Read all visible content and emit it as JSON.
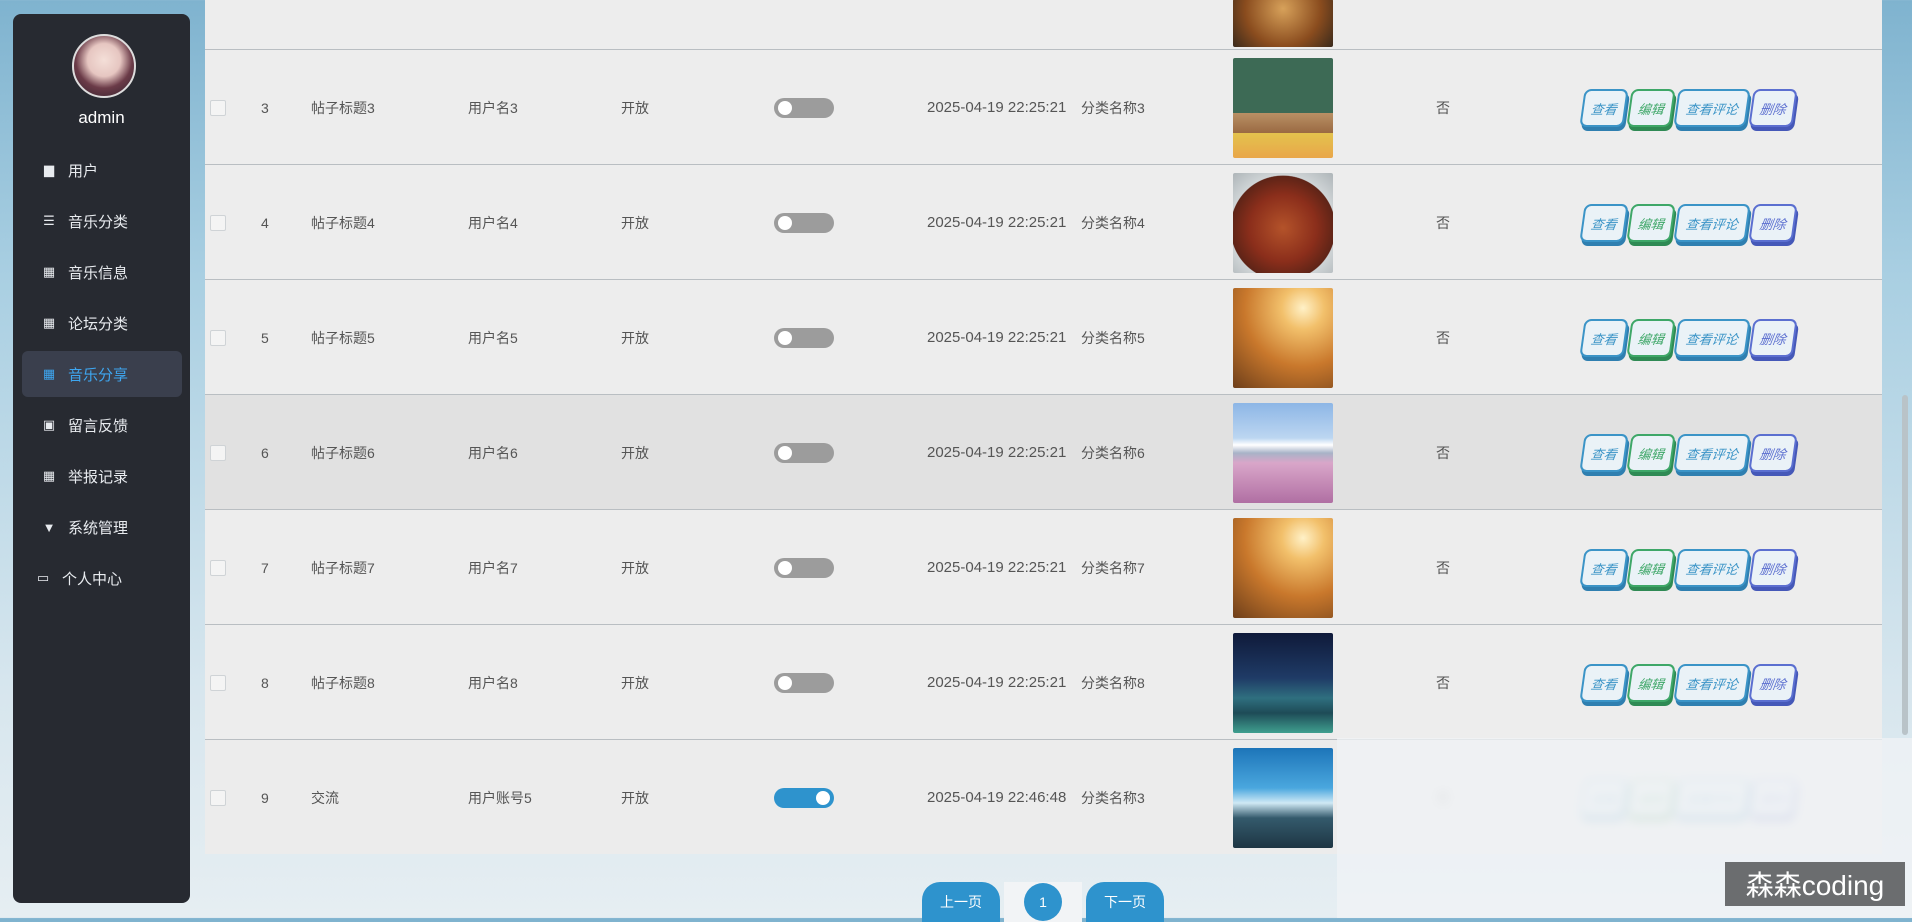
{
  "sidebar": {
    "username": "admin",
    "items": [
      {
        "label": "用户",
        "icon": "briefcase-icon"
      },
      {
        "label": "音乐分类",
        "icon": "sliders-icon"
      },
      {
        "label": "音乐信息",
        "icon": "grid-icon"
      },
      {
        "label": "论坛分类",
        "icon": "grid-icon"
      },
      {
        "label": "音乐分享",
        "icon": "grid-icon"
      },
      {
        "label": "留言反馈",
        "icon": "clipboard-icon"
      },
      {
        "label": "举报记录",
        "icon": "grid-icon"
      },
      {
        "label": "系统管理",
        "icon": "brush-icon"
      },
      {
        "label": "个人中心",
        "icon": "card-icon"
      }
    ],
    "active_index": 4
  },
  "table": {
    "rows": [
      {
        "id": "3",
        "title": "帖子标题3",
        "user": "用户名3",
        "status": "开放",
        "switch_on": false,
        "time": "2025-04-19 22:25:21",
        "category": "分类名称3",
        "flag": "否",
        "image": "classroom"
      },
      {
        "id": "4",
        "title": "帖子标题4",
        "user": "用户名4",
        "status": "开放",
        "switch_on": false,
        "time": "2025-04-19 22:25:21",
        "category": "分类名称4",
        "flag": "否",
        "image": "food"
      },
      {
        "id": "5",
        "title": "帖子标题5",
        "user": "用户名5",
        "status": "开放",
        "switch_on": false,
        "time": "2025-04-19 22:25:21",
        "category": "分类名称5",
        "flag": "否",
        "image": "runner"
      },
      {
        "id": "6",
        "title": "帖子标题6",
        "user": "用户名6",
        "status": "开放",
        "switch_on": false,
        "time": "2025-04-19 22:25:21",
        "category": "分类名称6",
        "flag": "否",
        "image": "mountain"
      },
      {
        "id": "7",
        "title": "帖子标题7",
        "user": "用户名7",
        "status": "开放",
        "switch_on": false,
        "time": "2025-04-19 22:25:21",
        "category": "分类名称7",
        "flag": "否",
        "image": "runner"
      },
      {
        "id": "8",
        "title": "帖子标题8",
        "user": "用户名8",
        "status": "开放",
        "switch_on": false,
        "time": "2025-04-19 22:25:21",
        "category": "分类名称8",
        "flag": "否",
        "image": "night-sky"
      },
      {
        "id": "9",
        "title": "交流",
        "user": "用户账号5",
        "status": "开放",
        "switch_on": true,
        "time": "2025-04-19 22:46:48",
        "category": "分类名称3",
        "flag": "否",
        "image": "meditation"
      }
    ],
    "actions": {
      "view": "查看",
      "edit": "编辑",
      "comments": "查看评论",
      "delete": "删除"
    }
  },
  "pagination": {
    "prev": "上一页",
    "page": "1",
    "next": "下一页"
  },
  "watermark": "森森coding",
  "colors": {
    "sidebar_bg": "#272a31",
    "accent": "#2e93cd",
    "active_text": "#3ea6f0"
  }
}
